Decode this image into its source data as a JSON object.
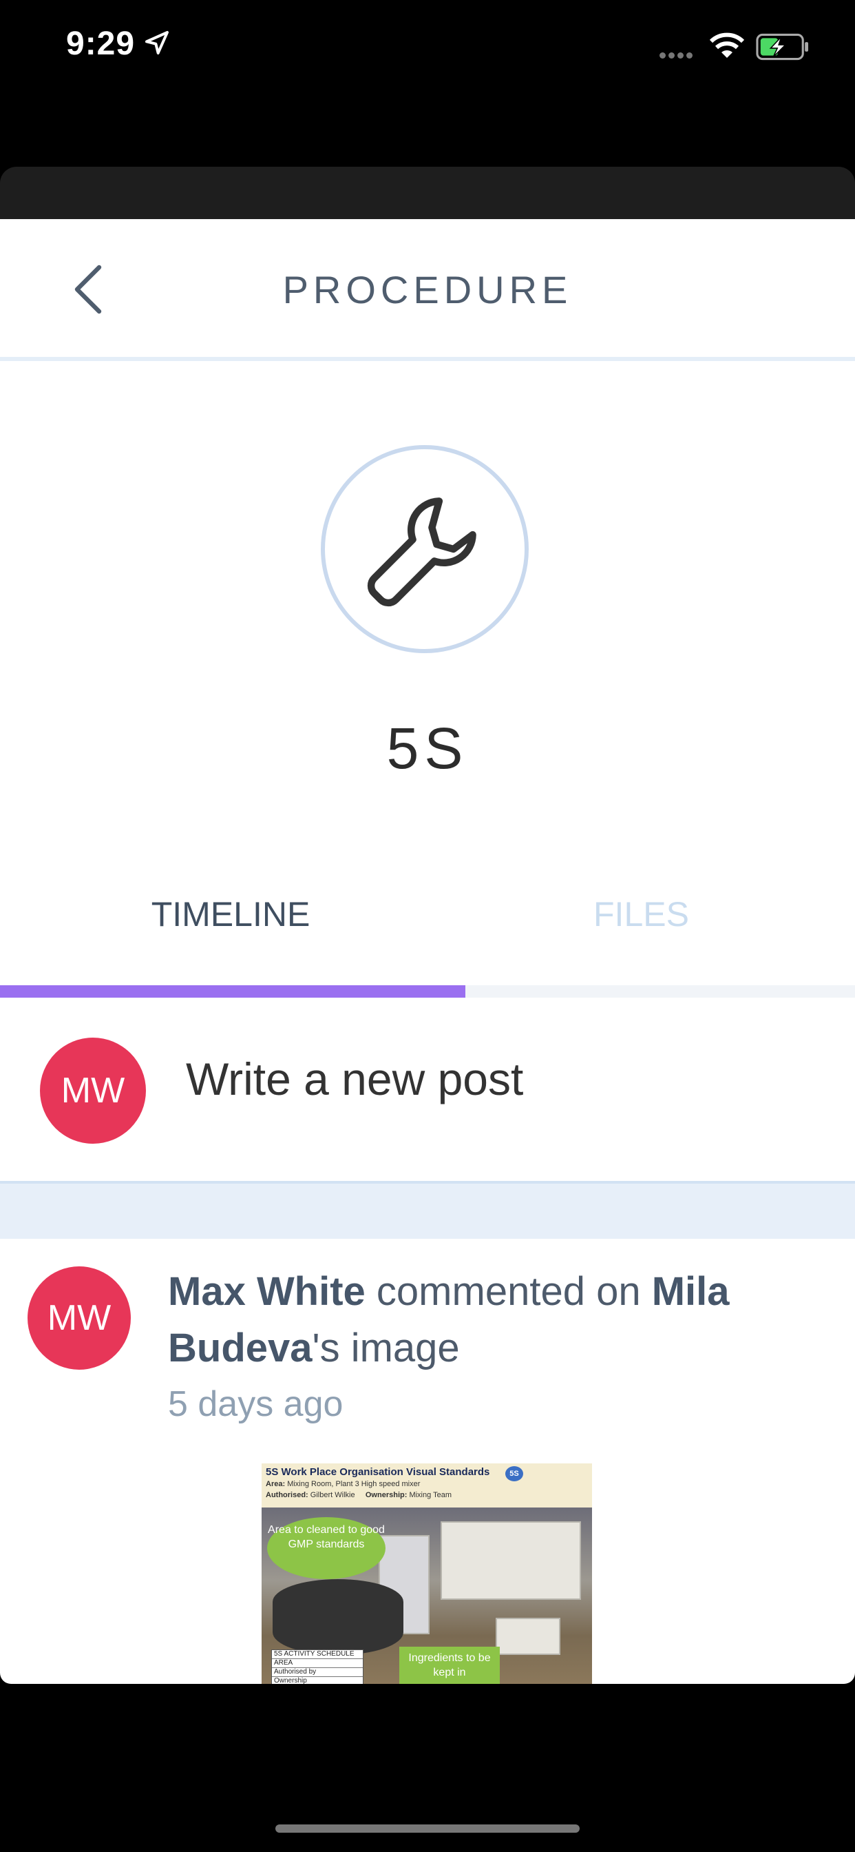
{
  "status_bar": {
    "time": "9:29"
  },
  "header": {
    "title": "PROCEDURE"
  },
  "procedure": {
    "name": "5S",
    "icon": "wrench-icon"
  },
  "tabs": [
    {
      "label": "TIMELINE",
      "active": true
    },
    {
      "label": "FILES",
      "active": false
    }
  ],
  "composer": {
    "avatar_initials": "MW",
    "placeholder": "Write a new post"
  },
  "post": {
    "avatar_initials": "MW",
    "author": "Max White",
    "action": " commented on ",
    "target": "Mila Budeva",
    "target_suffix": "'s image",
    "time": "5 days ago",
    "image": {
      "title": "5S Work Place Organisation Visual Standards",
      "area_label": "Area:",
      "area": "Mixing Room, Plant 3 High speed mixer",
      "authorised_label": "Authorised:",
      "authorised": "Gilbert Wilkie",
      "ownership_label": "Ownership:",
      "ownership": "Mixing Team",
      "badge": "5S",
      "callout_1": "Area to cleaned to good GMP standards",
      "callout_2": "Ingredients to be kept in",
      "schedule_title": "5S ACTIVITY SCHEDULE",
      "schedule_rows": [
        "AREA",
        "Authorised by",
        "Ownership"
      ]
    }
  },
  "colors": {
    "accent": "#9a6ff0",
    "avatar": "#e73658",
    "tab_inactive": "#c9dcef"
  }
}
